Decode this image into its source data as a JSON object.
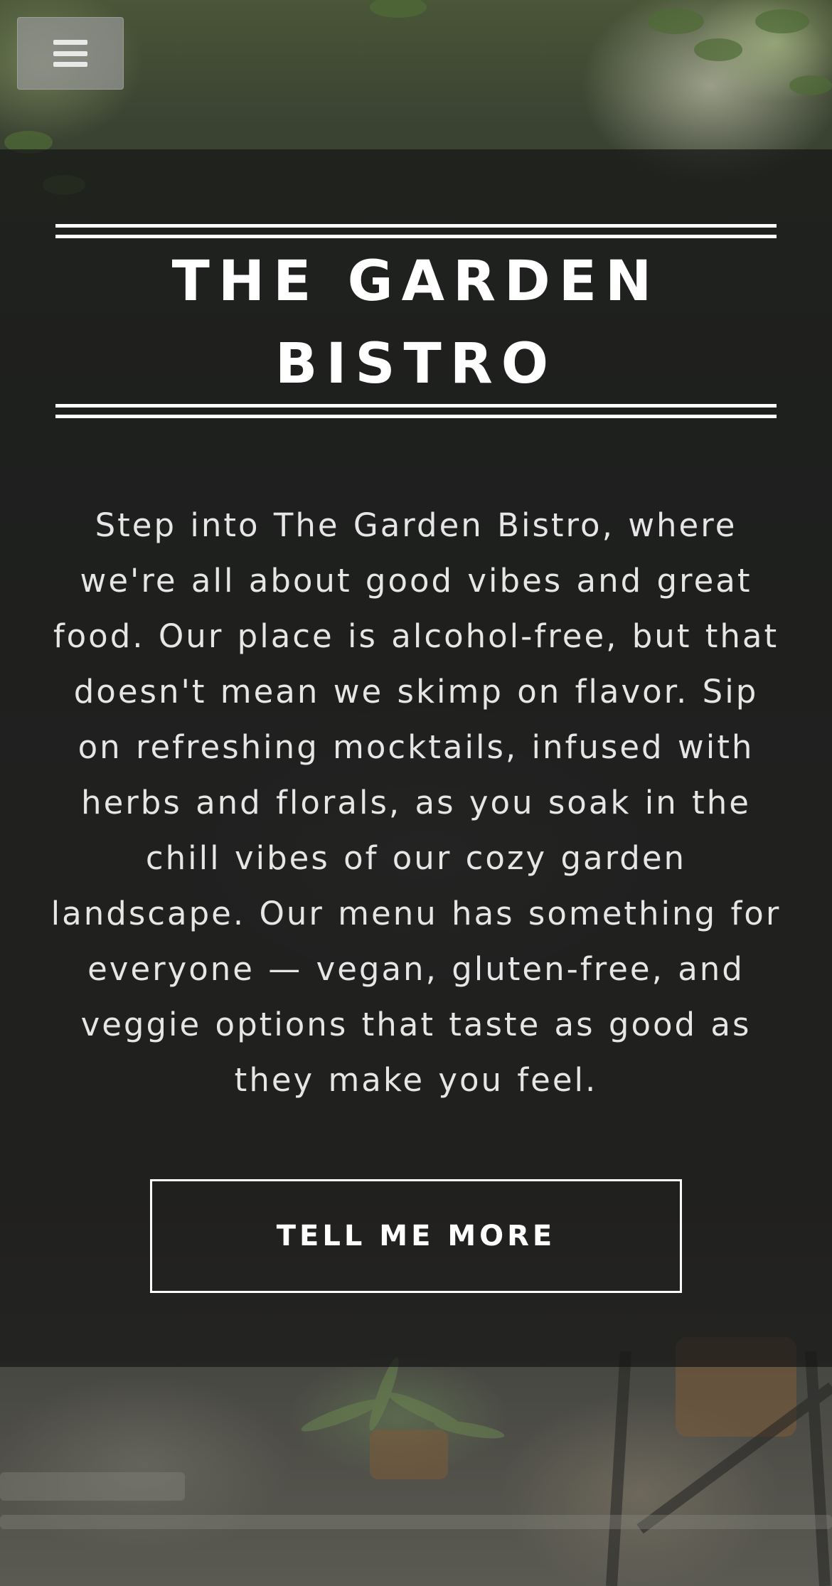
{
  "nav": {
    "menu_icon": "hamburger-menu-icon"
  },
  "hero": {
    "title": "THE GARDEN BISTRO",
    "description": "Step into The Garden Bistro, where we're all about good vibes and great food. Our place is alcohol-free, but that doesn't mean we skimp on flavor. Sip on refreshing mocktails, infused with herbs and florals, as you soak in the chill vibes of our cozy garden landscape. Our menu has something for everyone — vegan, gluten-free, and veggie options that taste as good as they make you feel.",
    "cta_label": "TELL ME MORE"
  },
  "colors": {
    "overlay": "#161616",
    "text": "#ffffff",
    "menu_button": "#969696"
  }
}
